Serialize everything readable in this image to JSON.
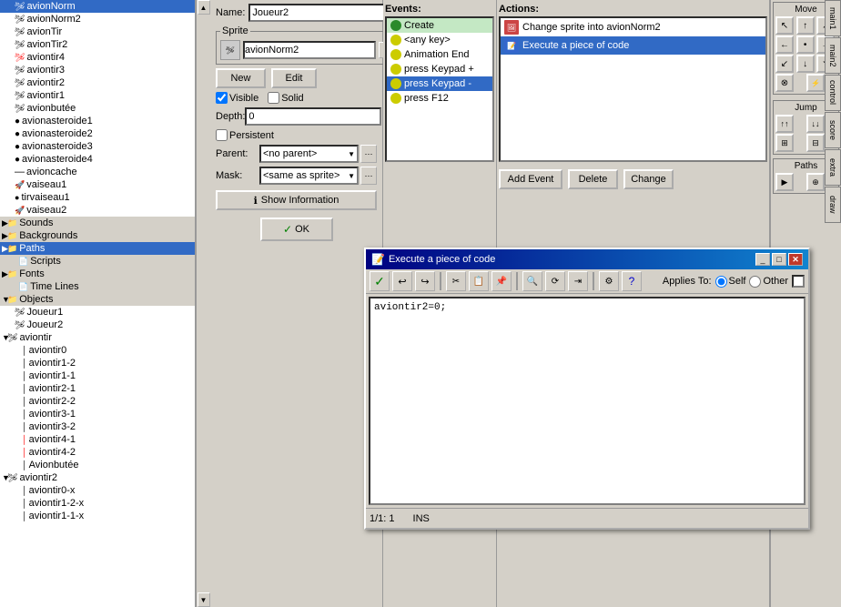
{
  "app": {
    "title": "Execute a piece of code"
  },
  "tree": {
    "items": [
      {
        "label": "avionNorm",
        "indent": 1,
        "icon": "🛩",
        "type": "sprite"
      },
      {
        "label": "avionNorm2",
        "indent": 1,
        "icon": "🛩",
        "type": "sprite"
      },
      {
        "label": "avionTir",
        "indent": 1,
        "icon": "🛩",
        "type": "sprite"
      },
      {
        "label": "avionTir2",
        "indent": 1,
        "icon": "🛩",
        "type": "sprite"
      },
      {
        "label": "aviontir4",
        "indent": 1,
        "icon": "🛩",
        "type": "sprite"
      },
      {
        "label": "aviontir3",
        "indent": 1,
        "icon": "🛩",
        "type": "sprite"
      },
      {
        "label": "aviontir2",
        "indent": 1,
        "icon": "🛩",
        "type": "sprite"
      },
      {
        "label": "aviontir1",
        "indent": 1,
        "icon": "🛩",
        "type": "sprite"
      },
      {
        "label": "avionbutée",
        "indent": 1,
        "icon": "🛩",
        "type": "sprite"
      },
      {
        "label": "avionasteroide1",
        "indent": 1,
        "icon": "●",
        "type": "asteroid"
      },
      {
        "label": "avionasteroide2",
        "indent": 1,
        "icon": "●",
        "type": "asteroid"
      },
      {
        "label": "avionasteroide3",
        "indent": 1,
        "icon": "●",
        "type": "asteroid"
      },
      {
        "label": "avionasteroide4",
        "indent": 1,
        "icon": "●",
        "type": "asteroid"
      },
      {
        "label": "avioncache",
        "indent": 1,
        "icon": "—",
        "type": "cache"
      },
      {
        "label": "vaiseau1",
        "indent": 1,
        "icon": "🚀",
        "type": "ship"
      },
      {
        "label": "tirvaiseau1",
        "indent": 1,
        "icon": "●",
        "type": "ship"
      },
      {
        "label": "vaiseau2",
        "indent": 1,
        "icon": "🚀",
        "type": "ship"
      }
    ],
    "sections": [
      {
        "label": "Sounds",
        "indent": 0,
        "expanded": true
      },
      {
        "label": "Backgrounds",
        "indent": 0,
        "expanded": true
      },
      {
        "label": "Paths",
        "indent": 0,
        "expanded": true,
        "selected": true
      },
      {
        "label": "Scripts",
        "indent": 1
      },
      {
        "label": "Fonts",
        "indent": 0,
        "expanded": false
      },
      {
        "label": "Time Lines",
        "indent": 1
      },
      {
        "label": "Objects",
        "indent": 0,
        "expanded": true
      },
      {
        "label": "Joueur1",
        "indent": 2
      },
      {
        "label": "Joueur2",
        "indent": 2
      },
      {
        "label": "aviontir",
        "indent": 2
      },
      {
        "label": "aviontir0",
        "indent": 3
      },
      {
        "label": "aviontir1-2",
        "indent": 3
      },
      {
        "label": "aviontir1-1",
        "indent": 3
      },
      {
        "label": "aviontir2-1",
        "indent": 3
      },
      {
        "label": "aviontir2-2",
        "indent": 3
      },
      {
        "label": "aviontir3-1",
        "indent": 3
      },
      {
        "label": "aviontir3-2",
        "indent": 3
      },
      {
        "label": "aviontir4-1",
        "indent": 3
      },
      {
        "label": "aviontir4-2",
        "indent": 3
      },
      {
        "label": "Avionbutée",
        "indent": 3
      },
      {
        "label": "aviontir2",
        "indent": 2
      },
      {
        "label": "aviontir0-x",
        "indent": 3
      },
      {
        "label": "aviontir1-2-x",
        "indent": 3
      },
      {
        "label": "aviontir1-1-x",
        "indent": 3
      }
    ]
  },
  "object_properties": {
    "name_label": "Name:",
    "name_value": "Joueur2",
    "sprite_label": "Sprite",
    "sprite_value": "avionNorm2",
    "new_btn": "New",
    "edit_btn": "Edit",
    "visible_label": "Visible",
    "solid_label": "Solid",
    "depth_label": "Depth:",
    "depth_value": "0",
    "persistent_label": "Persistent",
    "parent_label": "Parent:",
    "parent_value": "<no parent>",
    "mask_label": "Mask:",
    "mask_value": "<same as sprite>",
    "show_info_btn": "Show Information",
    "ok_btn": "OK"
  },
  "events": {
    "title": "Events:",
    "items": [
      {
        "label": "Create",
        "type": "green",
        "selected": false
      },
      {
        "label": "<any key>",
        "type": "yellow",
        "selected": false
      },
      {
        "label": "Animation End",
        "type": "yellow",
        "selected": false
      },
      {
        "label": "press Keypad +",
        "type": "yellow",
        "selected": false
      },
      {
        "label": "press Keypad -",
        "type": "yellow",
        "selected": false
      },
      {
        "label": "press F12",
        "type": "yellow",
        "selected": false
      }
    ]
  },
  "actions": {
    "title": "Actions:",
    "items": [
      {
        "label": "Change sprite into avionNorm2",
        "type": "red",
        "selected": false
      },
      {
        "label": "Execute a piece of code",
        "type": "blue",
        "selected": true
      }
    ],
    "add_event_btn": "Add Event",
    "delete_btn": "Delete",
    "change_btn": "Change"
  },
  "code_dialog": {
    "title": "Execute a piece of code",
    "code": "aviontir2=0;",
    "applies_to_label": "Applies To:",
    "self_label": "Self",
    "other_label": "Other",
    "status_pos": "1/1:  1",
    "status_mode": "INS"
  },
  "right_panel": {
    "move_title": "Move",
    "jump_title": "Jump",
    "paths_title": "Paths",
    "tabs": [
      "main1",
      "main2",
      "control",
      "score",
      "extra",
      "draw"
    ]
  }
}
